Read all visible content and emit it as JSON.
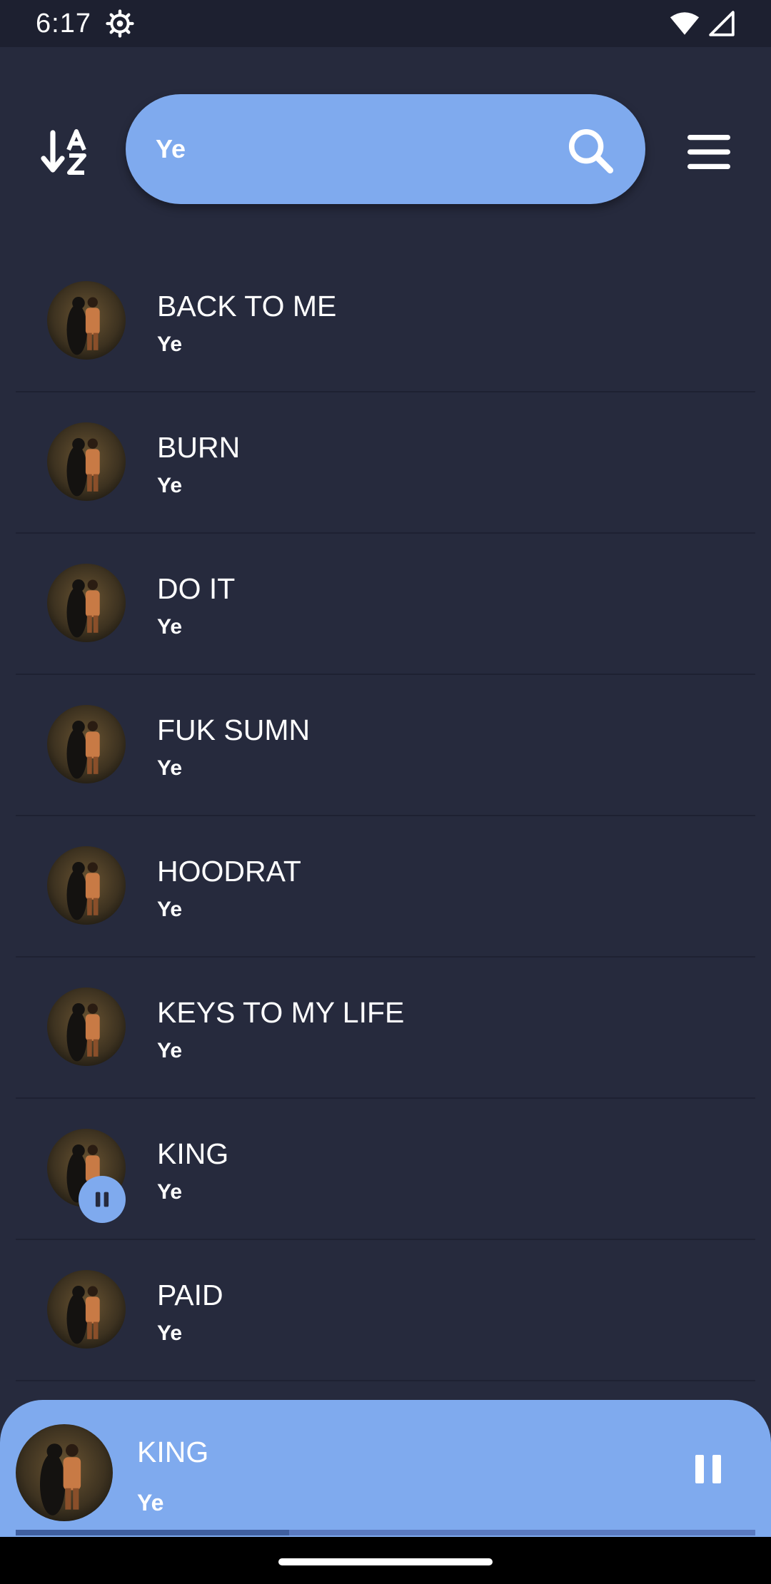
{
  "status_bar": {
    "time": "6:17"
  },
  "search": {
    "value": "Ye",
    "placeholder": "Ye"
  },
  "songs": [
    {
      "title": "BACK TO ME",
      "artist": "Ye",
      "playing": false
    },
    {
      "title": "BURN",
      "artist": "Ye",
      "playing": false
    },
    {
      "title": "DO IT",
      "artist": "Ye",
      "playing": false
    },
    {
      "title": "FUK SUMN",
      "artist": "Ye",
      "playing": false
    },
    {
      "title": "HOODRAT",
      "artist": "Ye",
      "playing": false
    },
    {
      "title": "KEYS TO MY LIFE",
      "artist": "Ye",
      "playing": false
    },
    {
      "title": "KING",
      "artist": "Ye",
      "playing": true
    },
    {
      "title": "PAID",
      "artist": "Ye",
      "playing": false
    }
  ],
  "now_playing": {
    "title": "KING",
    "artist": "Ye",
    "progress": 0.37
  },
  "colors": {
    "background": "#262a3d",
    "accent": "#7faaee",
    "status_bar": "#1d2030"
  },
  "icons": {
    "sort": "sort-alpha-down-icon",
    "search": "search-icon",
    "menu": "hamburger-menu-icon",
    "pause": "pause-icon",
    "gear": "gear-icon",
    "wifi": "wifi-icon",
    "signal": "cell-signal-icon"
  }
}
